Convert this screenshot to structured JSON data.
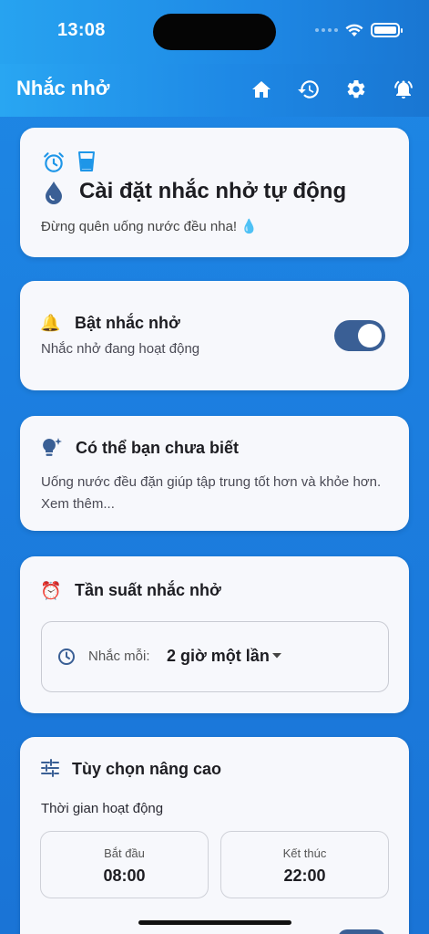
{
  "status": {
    "time": "13:08"
  },
  "appbar": {
    "title": "Nhắc nhở",
    "actions": [
      "home-icon",
      "history-icon",
      "settings-icon",
      "alarm-bell-icon"
    ]
  },
  "header_card": {
    "title": "Cài đặt nhắc nhở tự động",
    "subtitle": "Đừng quên uống nước đều nha! 💧"
  },
  "reminder_card": {
    "title": "Bật nhắc nhở",
    "subtitle": "Nhắc nhở đang hoạt động",
    "enabled": true,
    "icon": "🔔"
  },
  "tip_card": {
    "title": "Có thể bạn chưa biết",
    "body": "Uống nước đều đặn giúp tập trung tốt hơn và khỏe hơn. Xem thêm..."
  },
  "frequency_card": {
    "title": "Tần suất nhắc nhở",
    "icon": "⏰",
    "dropdown_label": "Nhắc mỗi:",
    "dropdown_value": "2 giờ một lần"
  },
  "advanced_card": {
    "title": "Tùy chọn nâng cao",
    "section_label": "Thời gian hoạt động",
    "start_label": "Bắt đầu",
    "start_value": "08:00",
    "end_label": "Kết thúc",
    "end_value": "22:00"
  },
  "colors": {
    "accent": "#1e88e5",
    "toggle": "#3a5f95",
    "card": "#f7f8fc"
  }
}
